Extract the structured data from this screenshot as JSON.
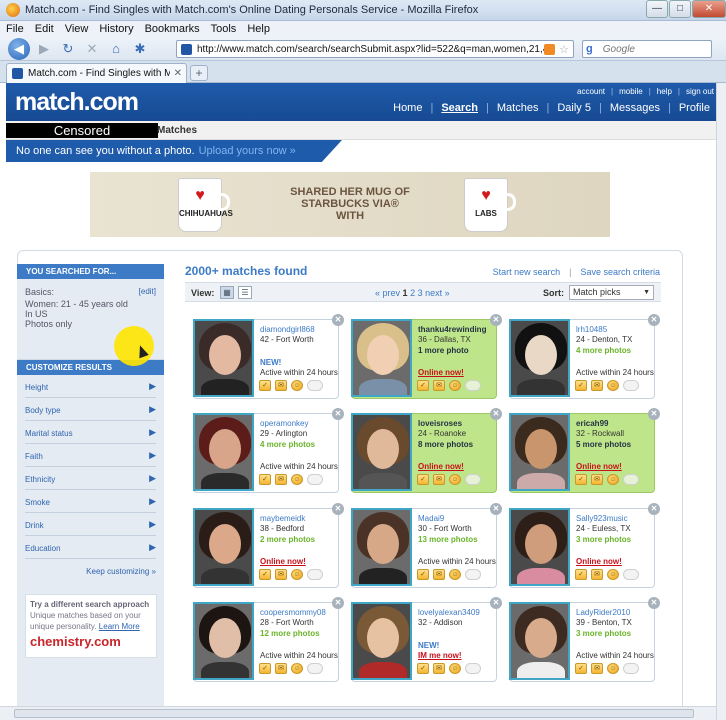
{
  "window": {
    "title": "Match.com - Find Singles with Match.com's Online Dating Personals Service - Mozilla Firefox"
  },
  "menu": [
    "File",
    "Edit",
    "View",
    "History",
    "Bookmarks",
    "Tools",
    "Help"
  ],
  "browser": {
    "url": "http://www.match.com/search/searchSubmit.aspx?lid=522&q=man,women,21,45&pn=",
    "search_placeholder": "Google",
    "tab_label": "Match.com - Find Singles with Match.com's Online Dating Personals Service"
  },
  "site": {
    "logo": "match.com",
    "top_links": [
      "account",
      "mobile",
      "help",
      "sign out"
    ],
    "nav": [
      "Home",
      "Search",
      "Matches",
      "Daily 5",
      "Messages",
      "Profile"
    ],
    "censored": "Censored",
    "breadcrumb": "Matches",
    "photo_msg": "No one can see you without a photo.",
    "upload_link": "Upload yours now »"
  },
  "ad": {
    "left_mug_text": "CHIHUAHUAS",
    "tagline": "SHARED HER MUG OF STARBUCKS VIA® WITH",
    "right_mug_text": "LABS"
  },
  "sidebar": {
    "searched_title": "YOU SEARCHED FOR...",
    "basics_label": "Basics:",
    "edit_label": "[edit]",
    "criteria": [
      "Women: 21 - 45 years old",
      "In US",
      "Photos only"
    ],
    "customize_title": "CUSTOMIZE RESULTS",
    "filters": [
      "Height",
      "Body type",
      "Marital status",
      "Faith",
      "Ethnicity",
      "Smoke",
      "Drink",
      "Education"
    ],
    "keep_customizing": "Keep customizing »",
    "chemistry": {
      "title": "Try a different search approach",
      "body": "Unique matches based on your unique personality.",
      "learn_more": "Learn More",
      "logo": "chemistry.com"
    }
  },
  "results": {
    "title": "2000+ matches found",
    "start_new": "Start new search",
    "save_criteria": "Save search criteria",
    "view_label": "View:",
    "prev": "« prev",
    "pages": [
      "1",
      "2",
      "3"
    ],
    "next": "next »",
    "sort_label": "Sort:",
    "sort_value": "Match picks",
    "cards": [
      {
        "name": "diamondgirl868",
        "meta": "42 - Fort Worth",
        "more": "",
        "new": "NEW!",
        "status": "Active within 24 hours",
        "online": false,
        "highlight": false
      },
      {
        "name": "thanku4rewinding",
        "meta": "36 - Dallas, TX",
        "more": "1 more photo",
        "new": "",
        "status": "Online now!",
        "online": true,
        "highlight": true
      },
      {
        "name": "lrh10485",
        "meta": "24 - Denton, TX",
        "more": "4 more photos",
        "new": "",
        "status": "Active within 24 hours",
        "online": false,
        "highlight": false
      },
      {
        "name": "operamonkey",
        "meta": "29 - Arlington",
        "more": "4 more photos",
        "new": "",
        "status": "Active within 24 hours",
        "online": false,
        "highlight": false
      },
      {
        "name": "loveisroses",
        "meta": "24 - Roanoke",
        "more": "8 more photos",
        "new": "",
        "status": "Online now!",
        "online": true,
        "highlight": true
      },
      {
        "name": "ericah99",
        "meta": "32 - Rockwall",
        "more": "5 more photos",
        "new": "",
        "status": "Online now!",
        "online": true,
        "highlight": true
      },
      {
        "name": "maybemeidk",
        "meta": "38 - Bedford",
        "more": "2 more photos",
        "new": "",
        "status": "Online now!",
        "online": true,
        "highlight": false
      },
      {
        "name": "Madai9",
        "meta": "30 - Fort Worth",
        "more": "13 more photos",
        "new": "",
        "status": "Active within 24 hours",
        "online": false,
        "highlight": false
      },
      {
        "name": "Sally923music",
        "meta": "24 - Euless, TX",
        "more": "3 more photos",
        "new": "",
        "status": "Online now!",
        "online": true,
        "highlight": false
      },
      {
        "name": "coopersmommy08",
        "meta": "28 - Fort Worth",
        "more": "12 more photos",
        "new": "",
        "status": "Active within 24 hours",
        "online": false,
        "highlight": false
      },
      {
        "name": "lovelyalexan3409",
        "meta": "32 - Addison",
        "more": "",
        "new": "NEW!",
        "status": "IM me now!",
        "online": true,
        "highlight": false
      },
      {
        "name": "LadyRider2010",
        "meta": "39 - Benton, TX",
        "more": "3 more photos",
        "new": "",
        "status": "Active within 24 hours",
        "online": false,
        "highlight": false
      }
    ]
  },
  "colors": {
    "brand_blue": "#1f5bab",
    "highlight_green": "#bfe58a",
    "online_red": "#c8101b",
    "photo_border": "#3fa6c6"
  }
}
